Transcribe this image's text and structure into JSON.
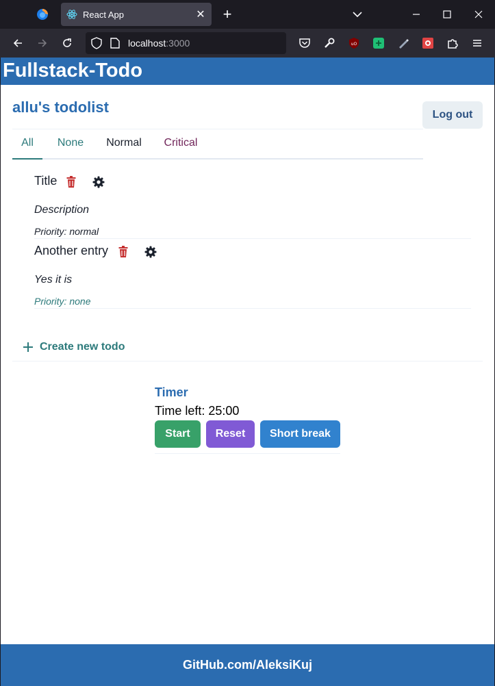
{
  "browser": {
    "tab_title": "React App",
    "url_host": "localhost",
    "url_port": ":3000"
  },
  "app": {
    "title": "Fullstack-Todo",
    "list_heading": "allu's todolist",
    "logout_label": "Log out"
  },
  "filter_tabs": [
    {
      "label": "All",
      "color": "#2c7a7b",
      "active": true
    },
    {
      "label": "None",
      "color": "#2c7a7b",
      "active": false
    },
    {
      "label": "Normal",
      "color": "#1a202c",
      "active": false
    },
    {
      "label": "Critical",
      "color": "#702459",
      "active": false
    }
  ],
  "todos": [
    {
      "title": "Title",
      "description": "Description",
      "priority": "Priority: normal",
      "priority_color": "#1a202c"
    },
    {
      "title": "Another entry",
      "description": "Yes it is",
      "priority": "Priority: none",
      "priority_color": "#2c7a7b"
    }
  ],
  "create_label": "Create new todo",
  "timer": {
    "title": "Timer",
    "time_left": "Time left: 25:00",
    "start_label": "Start",
    "reset_label": "Reset",
    "short_break_label": "Short break",
    "start_color": "#38a169",
    "reset_color": "#805ad5",
    "short_break_color": "#3182ce"
  },
  "footer": {
    "text": "GitHub.com/AleksiKuj"
  },
  "colors": {
    "brand": "#2b6cb0",
    "danger": "#c53030"
  },
  "icons": {
    "browser": [
      "firefox-icon",
      "react-icon",
      "close-icon",
      "plus-icon",
      "chevron-down-icon",
      "minimize-icon",
      "maximize-icon",
      "close-window-icon",
      "back-icon",
      "forward-icon",
      "reload-icon",
      "shield-icon",
      "page-icon",
      "star-icon",
      "pocket-icon",
      "wrench-icon",
      "ublock-icon",
      "extension-green-icon",
      "pen-icon",
      "extension-red-icon",
      "puzzle-icon",
      "menu-icon"
    ],
    "todo": [
      "trash-icon",
      "gear-icon"
    ]
  }
}
